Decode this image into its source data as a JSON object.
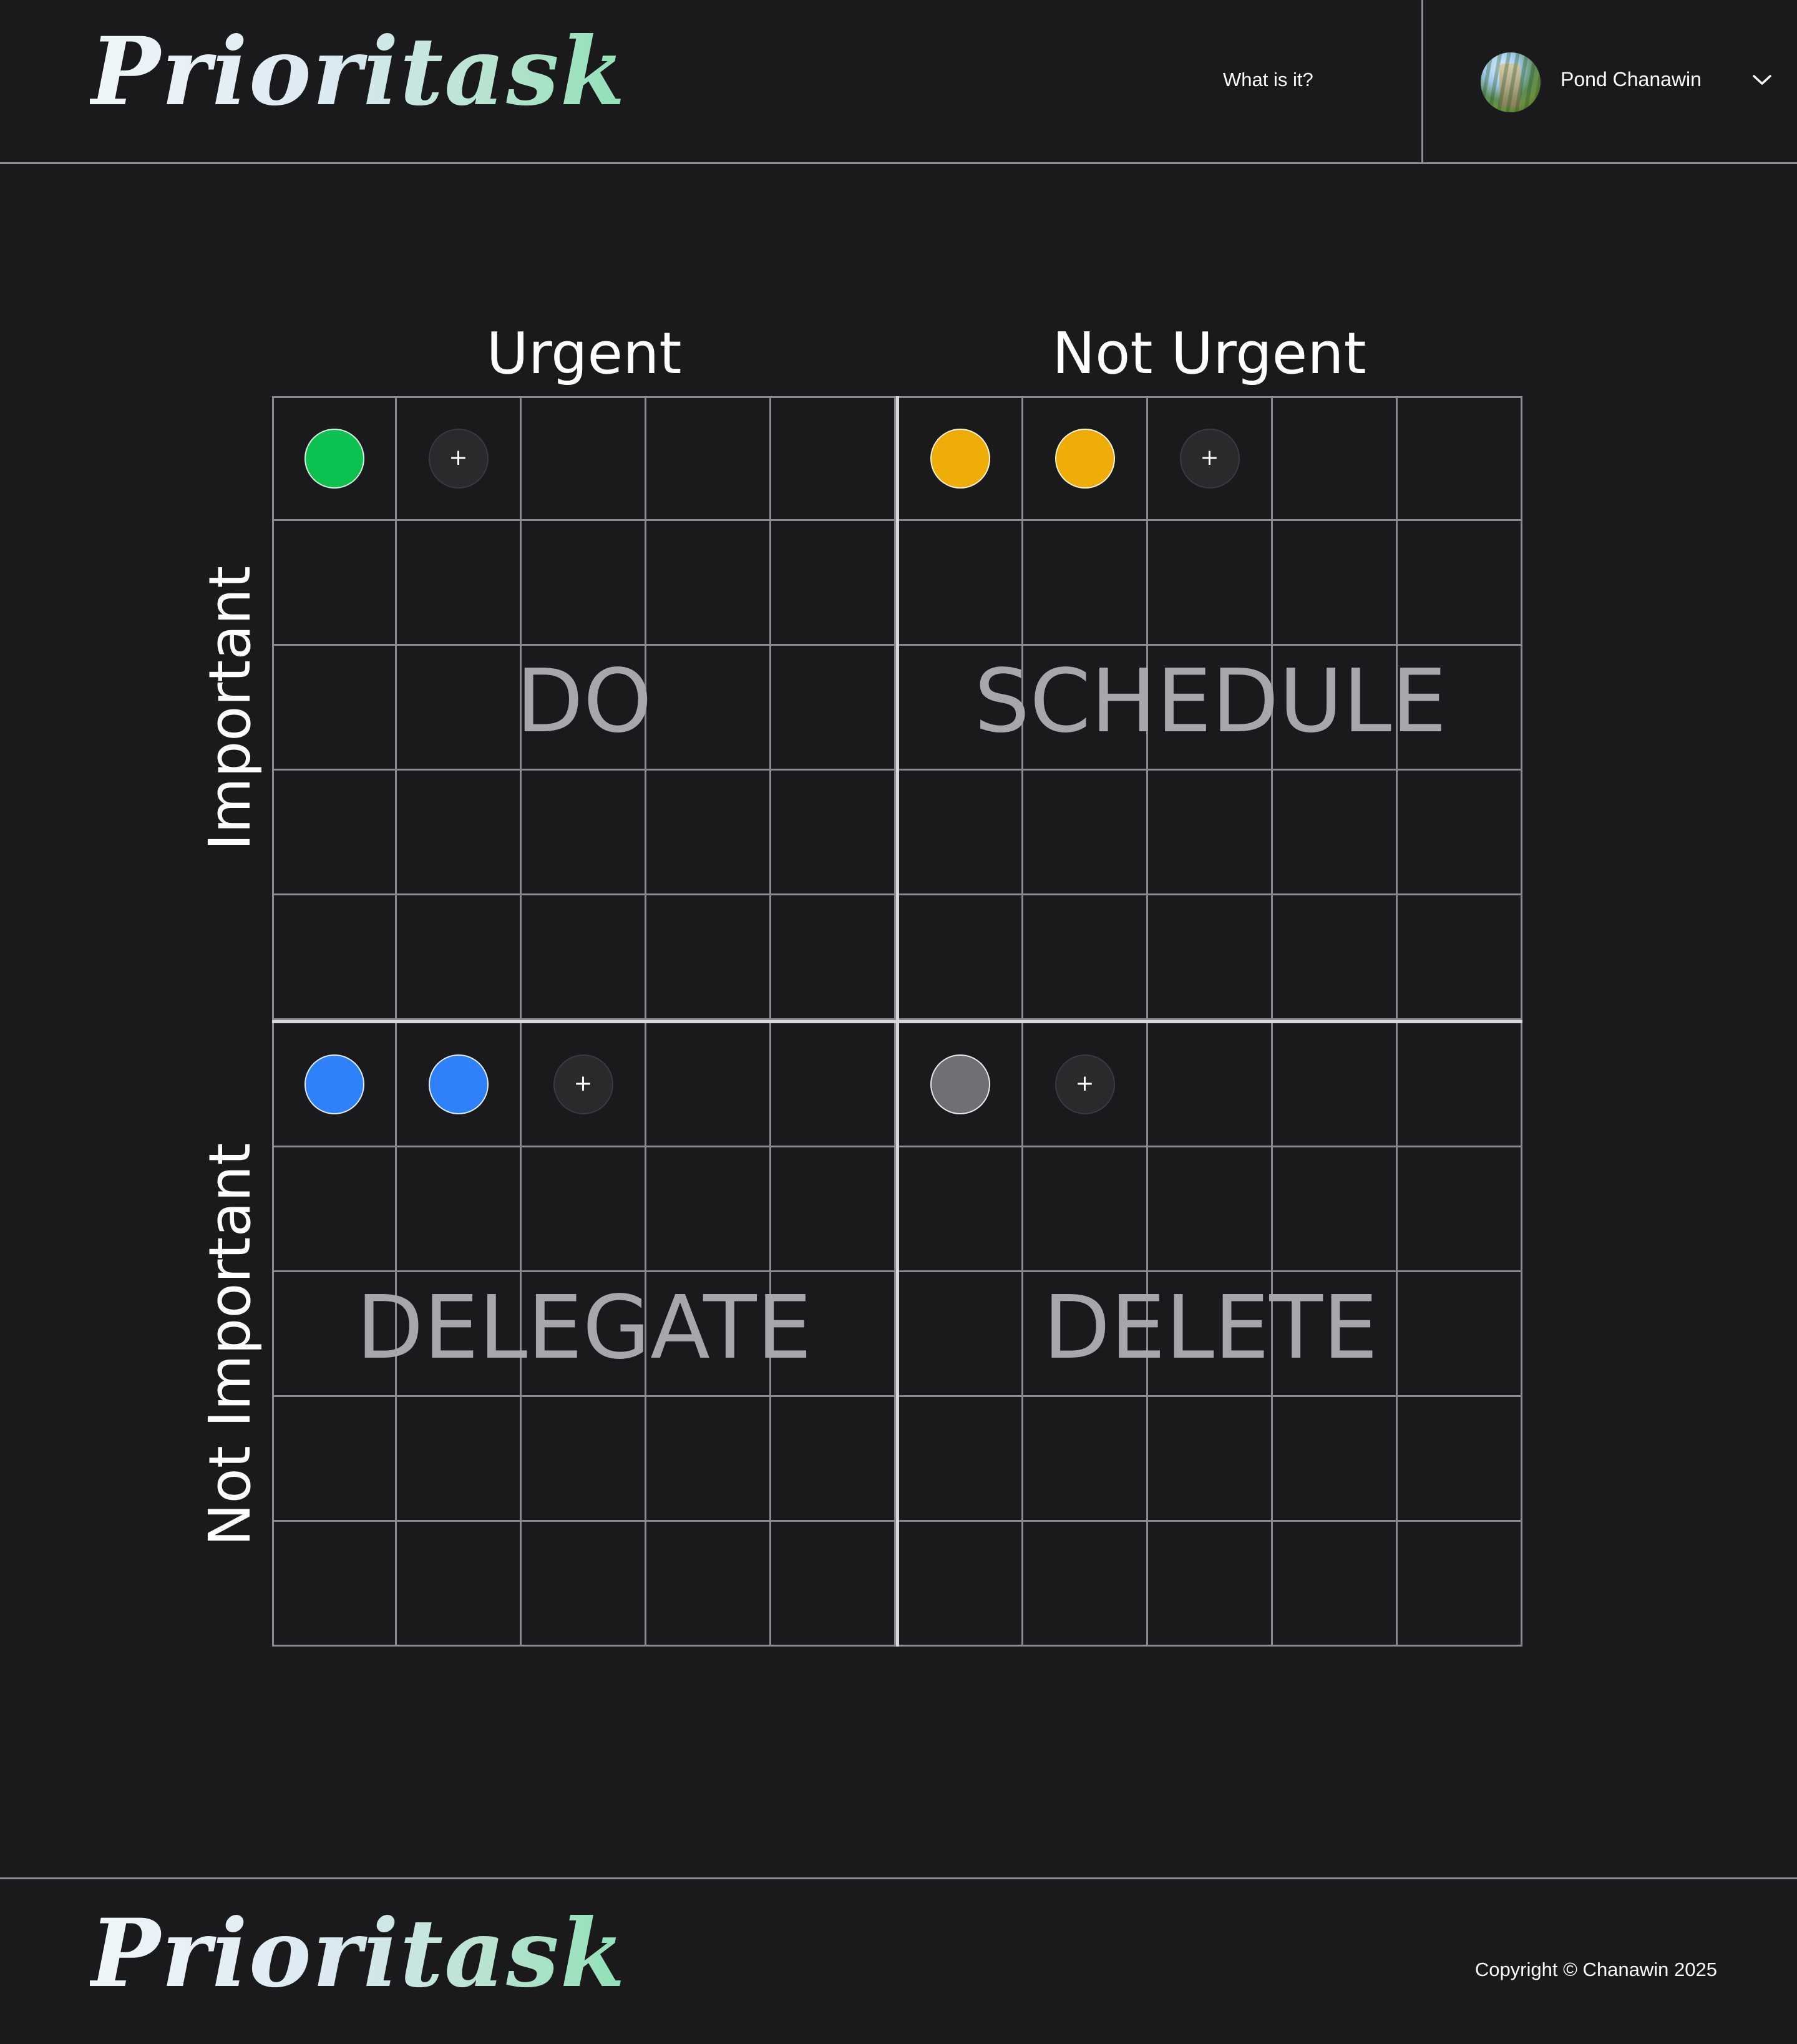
{
  "header": {
    "logo_text": "Prioritask",
    "nav_link": "What is it?",
    "user_name": "Pond Chanawin"
  },
  "matrix": {
    "column_labels": [
      "Urgent",
      "Not Urgent"
    ],
    "row_labels": [
      "Important",
      "Not Important"
    ],
    "quadrants": [
      {
        "label": "DO",
        "position": "top-left",
        "tasks": [
          {
            "color": "#0bc14f"
          }
        ],
        "add_label": "+"
      },
      {
        "label": "SCHEDULE",
        "position": "top-right",
        "tasks": [
          {
            "color": "#eeac06"
          },
          {
            "color": "#eeac06"
          }
        ],
        "add_label": "+"
      },
      {
        "label": "DELEGATE",
        "position": "bottom-left",
        "tasks": [
          {
            "color": "#2f80fb"
          },
          {
            "color": "#2f80fb"
          }
        ],
        "add_label": "+"
      },
      {
        "label": "DELETE",
        "position": "bottom-right",
        "tasks": [
          {
            "color": "#6f6f74"
          }
        ],
        "add_label": "+"
      }
    ]
  },
  "footer": {
    "logo_text": "Prioritask",
    "copyright": "Copyright © Chanawin 2025"
  },
  "colors": {
    "background": "#1a1a1d",
    "grid_line": "#8b8b8f",
    "divider": "#d8d8dc",
    "quadrant_label": "#a8a6ad"
  }
}
